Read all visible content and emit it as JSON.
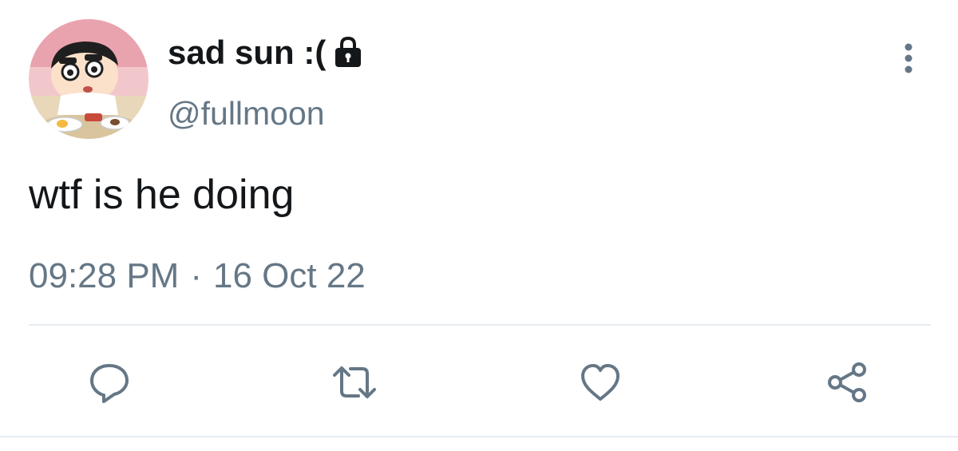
{
  "tweet": {
    "display_name": "sad sun :(",
    "handle": "@fullmoon",
    "text": "wtf is he doing",
    "time": "09:28 PM",
    "separator": "·",
    "date": "16 Oct 22",
    "protected": true
  },
  "icons": {
    "avatar": "avatar-image",
    "lock": "lock-icon",
    "more": "more-vertical-icon",
    "reply": "reply-icon",
    "retweet": "retweet-icon",
    "like": "heart-icon",
    "share": "share-icon"
  },
  "colors": {
    "text_primary": "#14171a",
    "text_secondary": "#657786",
    "icon": "#657786",
    "divider": "#e6ecf0"
  }
}
